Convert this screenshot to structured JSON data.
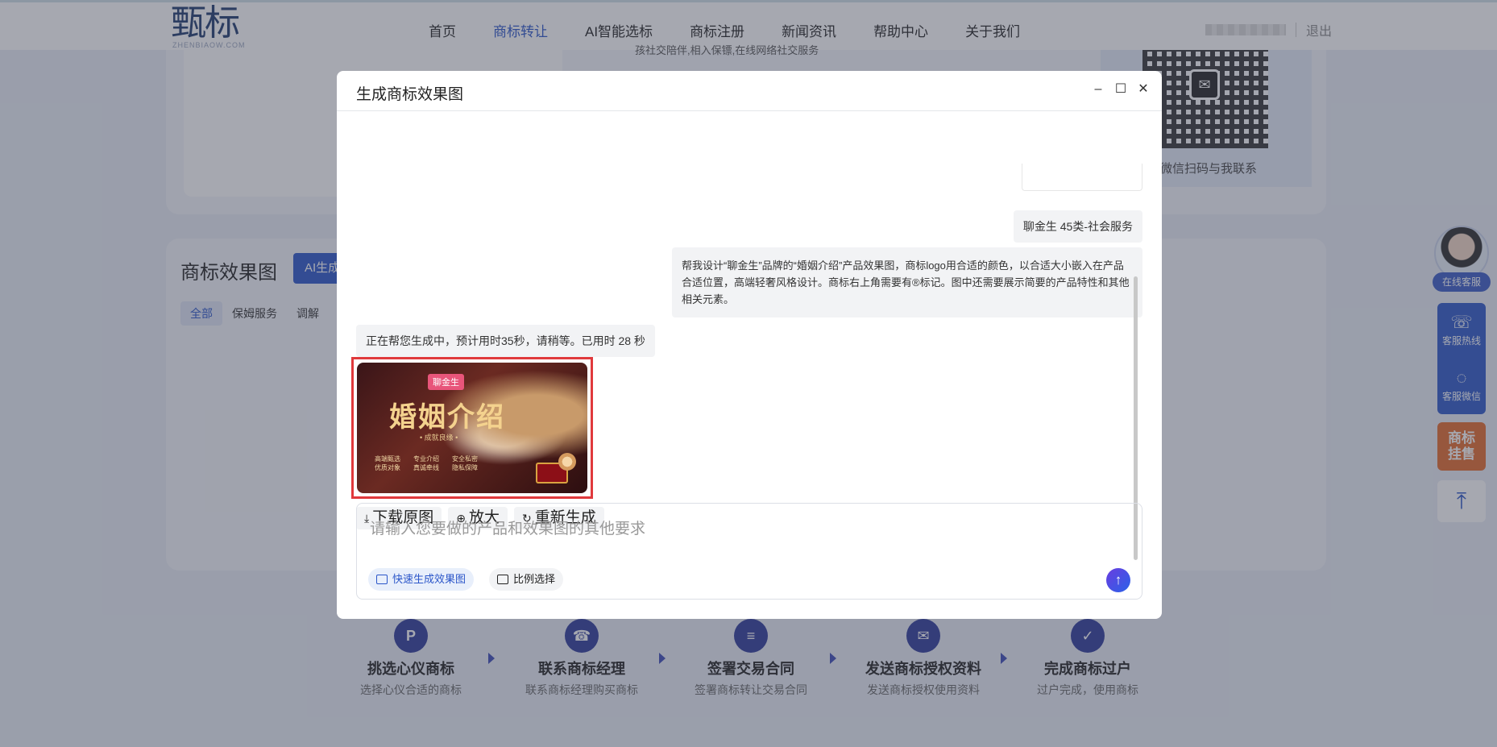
{
  "header": {
    "logo_text": "甄标",
    "logo_sub": "ZHENBIAOW.COM",
    "nav": [
      {
        "label": "首页"
      },
      {
        "label": "商标转让"
      },
      {
        "label": "AI智能选标"
      },
      {
        "label": "商标注册"
      },
      {
        "label": "新闻资讯"
      },
      {
        "label": "帮助中心"
      },
      {
        "label": "关于我们"
      }
    ],
    "logout": "退出"
  },
  "top_section": {
    "partial_line": "孩社交陪伴,相入保镖,在线网络社交服务",
    "qr_caption": "微信扫码与我联系"
  },
  "main_section": {
    "title": "商标效果图",
    "ai_button": "AI生成",
    "filters": [
      "全部",
      "保姆服务",
      "调解"
    ]
  },
  "steps": [
    {
      "title": "挑选心仪商标",
      "desc": "选择心仪合适的商标",
      "icon": "P"
    },
    {
      "title": "联系商标经理",
      "desc": "联系商标经理购买商标",
      "icon": "☎"
    },
    {
      "title": "签署交易合同",
      "desc": "签署商标转让交易合同",
      "icon": "≡"
    },
    {
      "title": "发送商标授权资料",
      "desc": "发送商标授权使用资料",
      "icon": "✉"
    },
    {
      "title": "完成商标过户",
      "desc": "过户完成，使用商标",
      "icon": "✓"
    }
  ],
  "float_bar": {
    "online": "在线客服",
    "hotline": "客服热线",
    "wechat": "客服微信",
    "sale": "商标挂售",
    "top_icon": "⤒"
  },
  "modal": {
    "title": "生成商标效果图",
    "minimize": "–",
    "maximize": "☐",
    "close": "✕",
    "messages": {
      "user_short": "聊金生 45类-社会服务",
      "user_long": "帮我设计“聊金生”品牌的“婚姻介绍”产品效果图，商标logo用合适的颜色，以合适大小嵌入在产品合适位置，高端轻奢风格设计。商标右上角需要有®标记。图中还需要展示简要的产品特性和其他相关元素。",
      "bot_status": "正在帮您生成中，预计用时35秒，请稍等。已用时 28 秒"
    },
    "result_image": {
      "brand": "聊金生",
      "title": "婚姻介绍",
      "subtitle": "• 成就良缘 •",
      "features": [
        {
          "l1": "高端甄选",
          "l2": "优质对象"
        },
        {
          "l1": "专业介绍",
          "l2": "真诚牵线"
        },
        {
          "l1": "安全私密",
          "l2": "隐私保障"
        }
      ]
    },
    "actions": {
      "download": "下载原图",
      "zoom": "放大",
      "regenerate": "重新生成"
    },
    "input": {
      "placeholder": "请输入您要做的产品和效果图的其他要求",
      "value": "",
      "quick_chip": "快速生成效果图",
      "ratio_chip": "比例选择",
      "send_icon": "↑"
    }
  },
  "colors": {
    "accent": "#2b56c9",
    "highlight_border": "#e0393c",
    "sale_orange": "#e46a2c"
  }
}
